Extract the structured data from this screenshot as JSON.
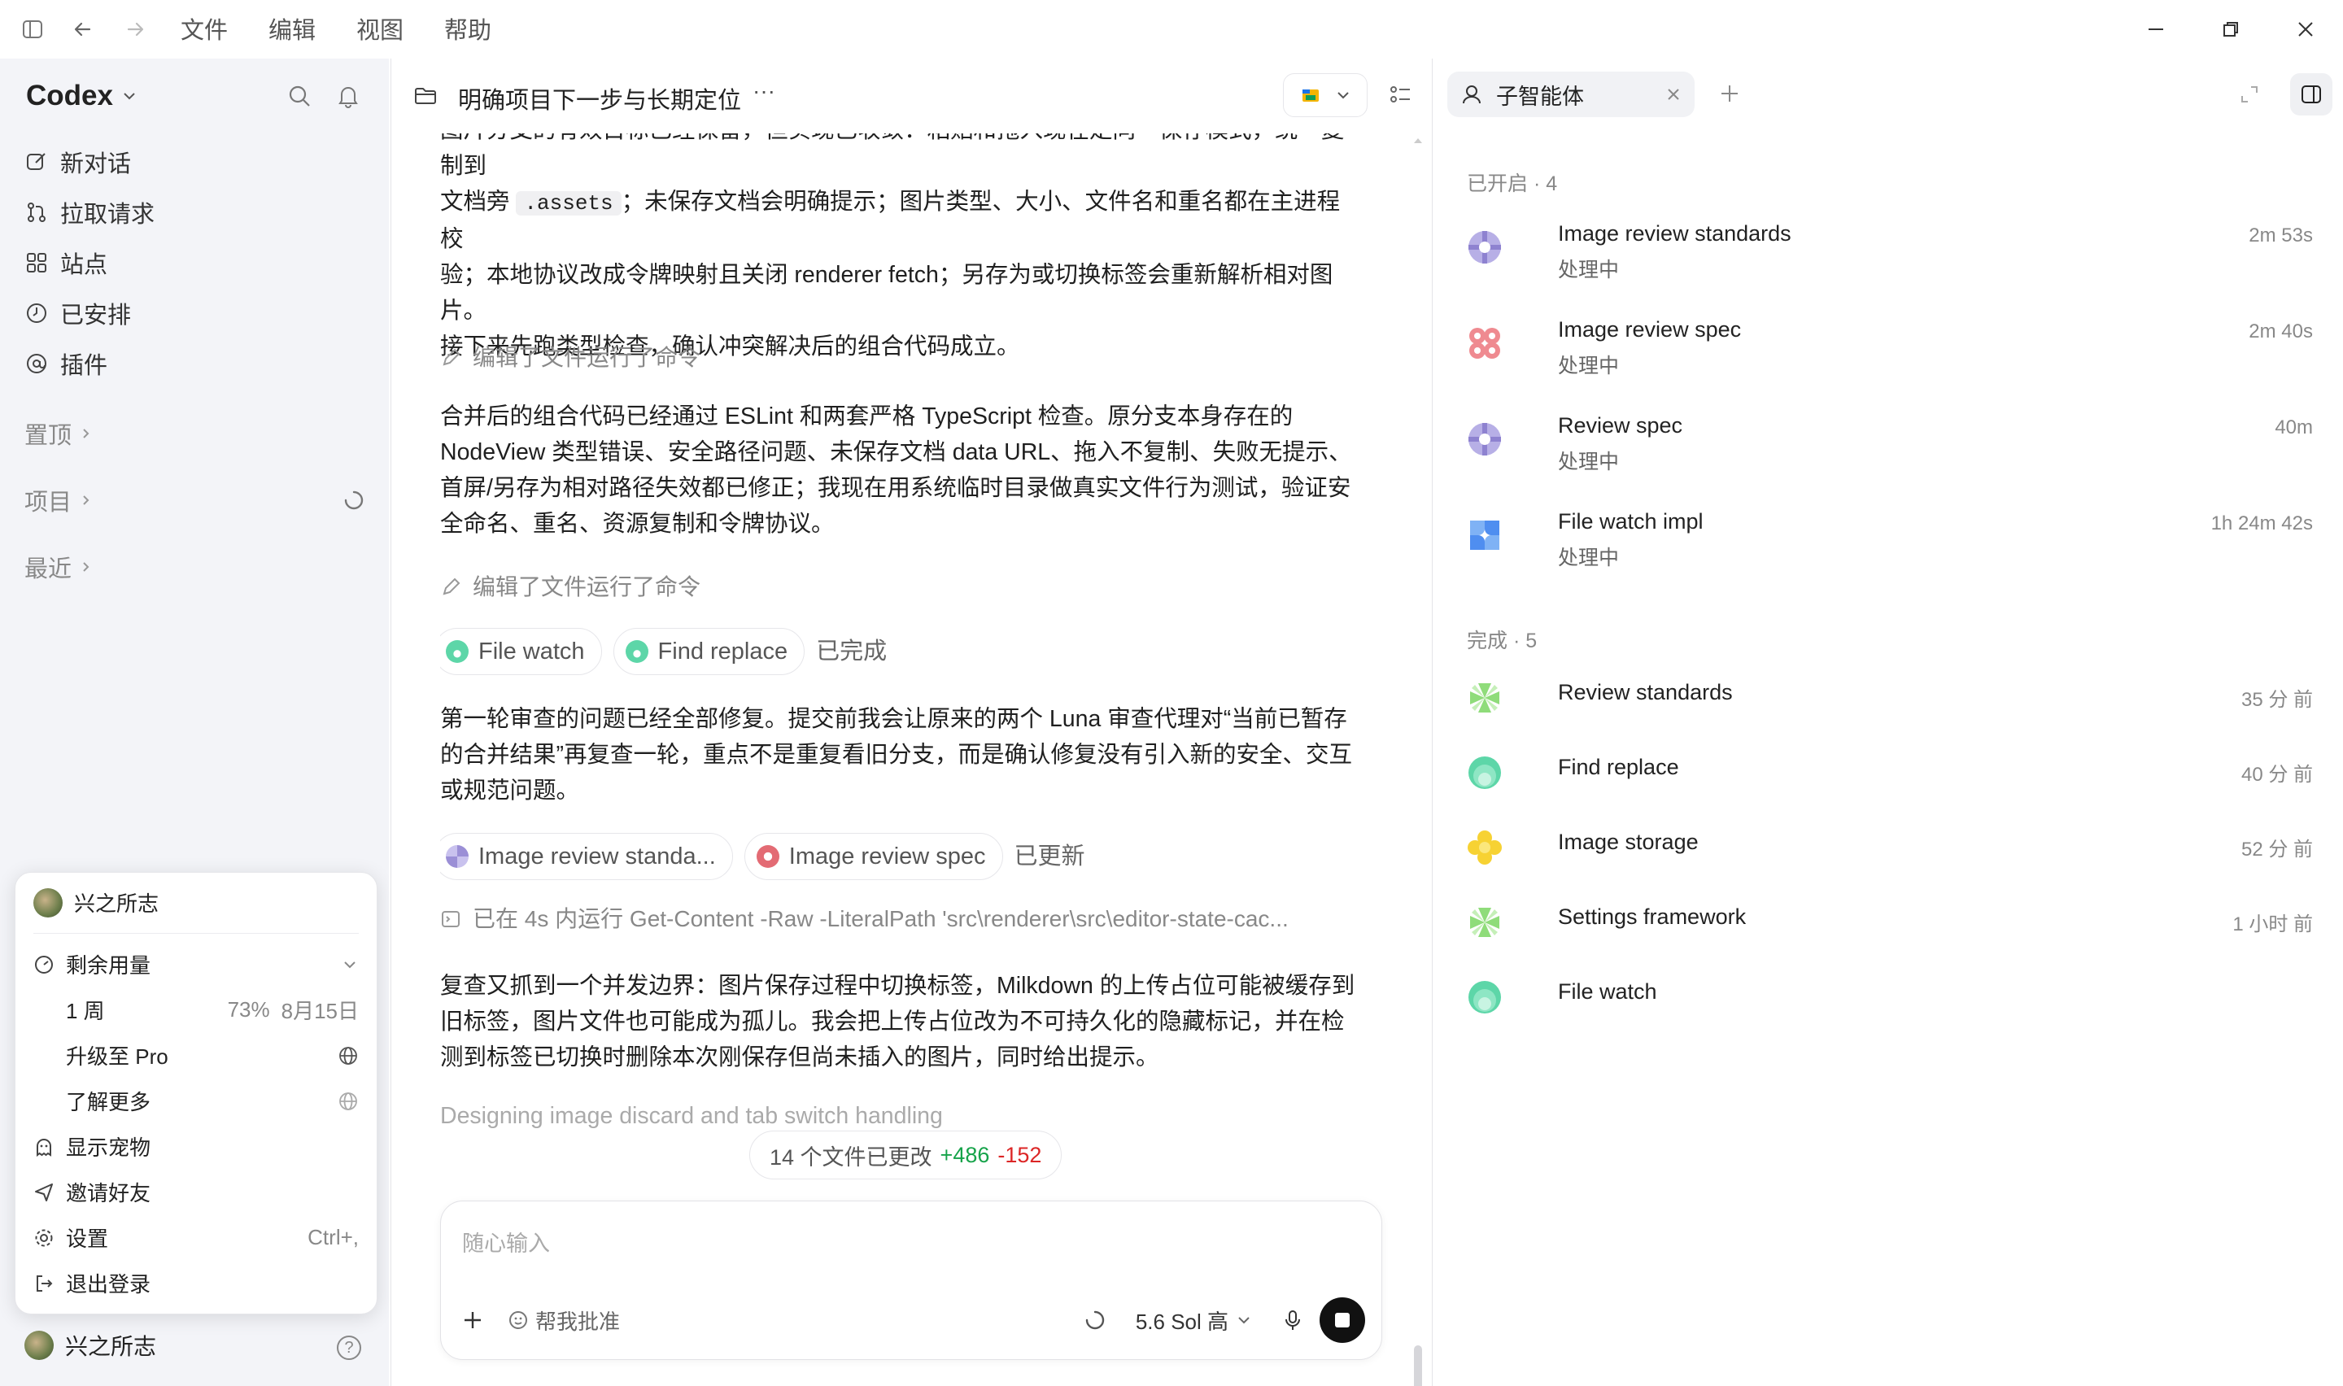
{
  "menu": [
    "文件",
    "编辑",
    "视图",
    "帮助"
  ],
  "sidebar": {
    "brand": "Codex",
    "nav": [
      {
        "label": "新对话",
        "icon": "edit-icon"
      },
      {
        "label": "拉取请求",
        "icon": "pull-request-icon"
      },
      {
        "label": "站点",
        "icon": "grid-icon"
      },
      {
        "label": "已安排",
        "icon": "clock-icon"
      },
      {
        "label": "插件",
        "icon": "at-icon"
      }
    ],
    "sections": [
      "置顶",
      "项目",
      "最近"
    ],
    "user": "兴之所志"
  },
  "popup": {
    "user": "兴之所志",
    "usage_label": "剩余用量",
    "week_label": "1 周",
    "week_percent": "73%",
    "week_date": "8月15日",
    "upgrade": "升级至 Pro",
    "learn_more": "了解更多",
    "show_pet": "显示宠物",
    "invite": "邀请好友",
    "settings": "设置",
    "settings_shortcut": "Ctrl+,",
    "logout": "退出登录"
  },
  "main": {
    "title": "明确项目下一步与长期定位",
    "more": "···",
    "para0_l1": "图片分支的有效目标已经保留，但实现已收敛：粘贴和拖入现在走同一保存模式，统一复制到",
    "para0_l2_a": "文档旁 ",
    "para0_l2_code": ".assets",
    "para0_l2_b": "；未保存文档会明确提示；图片类型、大小、文件名和重名都在主进程校",
    "para0_l3": "验；本地协议改成令牌映射且关闭 renderer fetch；另存为或切换标签会重新解析相对图片。",
    "para0_l4": "接下来先跑类型检查，确认冲突解决后的组合代码成立。",
    "cmd1": "编辑了文件运行了命令",
    "para1": "合并后的组合代码已经通过 ESLint 和两套严格 TypeScript 检查。原分支本身存在的 NodeView 类型错误、安全路径问题、未保存文档 data URL、拖入不复制、失败无提示、首屏/另存为相对路径失效都已修正；我现在用系统临时目录做真实文件行为测试，验证安全命名、重名、资源复制和令牌协议。",
    "cmd2": "编辑了文件运行了命令",
    "chips1": [
      {
        "label": "File watch",
        "color": "#5dd6a8"
      },
      {
        "label": "Find replace",
        "color": "#5dd6a8"
      }
    ],
    "chips1_status": "已完成",
    "para2": "第一轮审查的问题已经全部修复。提交前我会让原来的两个 Luna 审查代理对“当前已暂存的合并结果”再复查一轮，重点不是重复看旧分支，而是确认修复没有引入新的安全、交互或规范问题。",
    "chips2": [
      {
        "label": "Image review standa...",
        "color": "#9b8fd6"
      },
      {
        "label": "Image review spec",
        "color": "#e36b74"
      }
    ],
    "chips2_status": "已更新",
    "cmd3": "已在 4s 内运行 Get-Content -Raw -LiteralPath 'src\\renderer\\src\\editor-state-cac...",
    "para3": "复查又抓到一个并发边界：图片保存过程中切换标签，Milkdown 的上传占位可能被缓存到旧标签，图片文件也可能成为孤儿。我会把上传占位改为不可持久化的隐藏标记，并在检测到标签已切换时删除本次刚保存但尚未插入的图片，同时给出提示。",
    "thinking": "Designing image discard and tab switch handling",
    "changes_label": "14 个文件已更改",
    "changes_plus": "+486",
    "changes_minus": "-152",
    "composer_placeholder": "随心输入",
    "approve_label": "帮我批准",
    "model_label": "5.6 Sol 高"
  },
  "right": {
    "tab_label": "子智能体",
    "active_header": "已开启 · 4",
    "active": [
      {
        "name": "Image review standards",
        "status": "处理中",
        "time": "2m 53s",
        "icon": "purple"
      },
      {
        "name": "Image review spec",
        "status": "处理中",
        "time": "2m 40s",
        "icon": "red"
      },
      {
        "name": "Review spec",
        "status": "处理中",
        "time": "40m",
        "icon": "purple"
      },
      {
        "name": "File watch impl",
        "status": "处理中",
        "time": "1h 24m 42s",
        "icon": "blue"
      }
    ],
    "done_header": "完成 · 5",
    "done": [
      {
        "name": "Review standards",
        "time": "35 分 前",
        "icon": "green-star"
      },
      {
        "name": "Find replace",
        "time": "40 分 前",
        "icon": "teal"
      },
      {
        "name": "Image storage",
        "time": "52 分 前",
        "icon": "yellow"
      },
      {
        "name": "Settings framework",
        "time": "1 小时 前",
        "icon": "green-star"
      },
      {
        "name": "File watch",
        "time": "",
        "icon": "teal"
      }
    ]
  },
  "colors": {
    "accent_plus": "#16a34a",
    "accent_minus": "#dc2626"
  }
}
